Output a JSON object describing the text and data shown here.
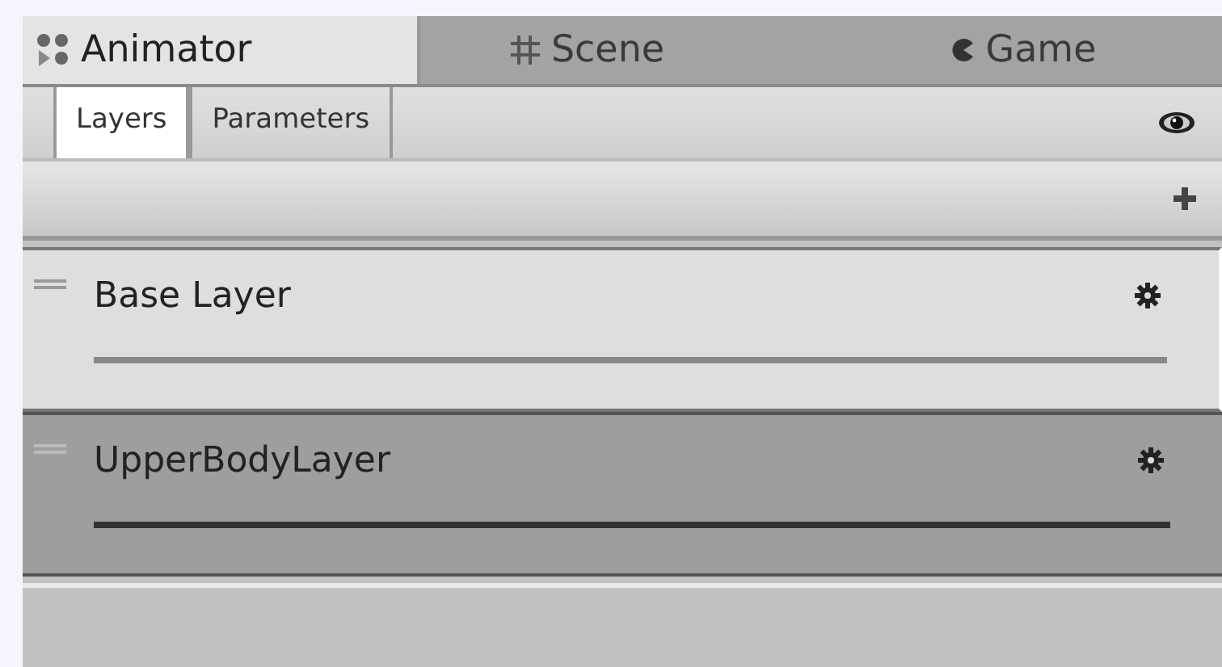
{
  "window_tabs": [
    {
      "label": "Animator",
      "kind": "nodes",
      "selected": true
    },
    {
      "label": "Scene",
      "kind": "grid",
      "selected": false
    },
    {
      "label": "Game",
      "kind": "pacman",
      "selected": false
    }
  ],
  "sub_tabs": [
    {
      "label": "Layers",
      "selected": true
    },
    {
      "label": "Parameters",
      "selected": false
    }
  ],
  "layers": [
    {
      "name": "Base Layer",
      "selected": true
    },
    {
      "name": "UpperBodyLayer",
      "selected": false
    }
  ]
}
